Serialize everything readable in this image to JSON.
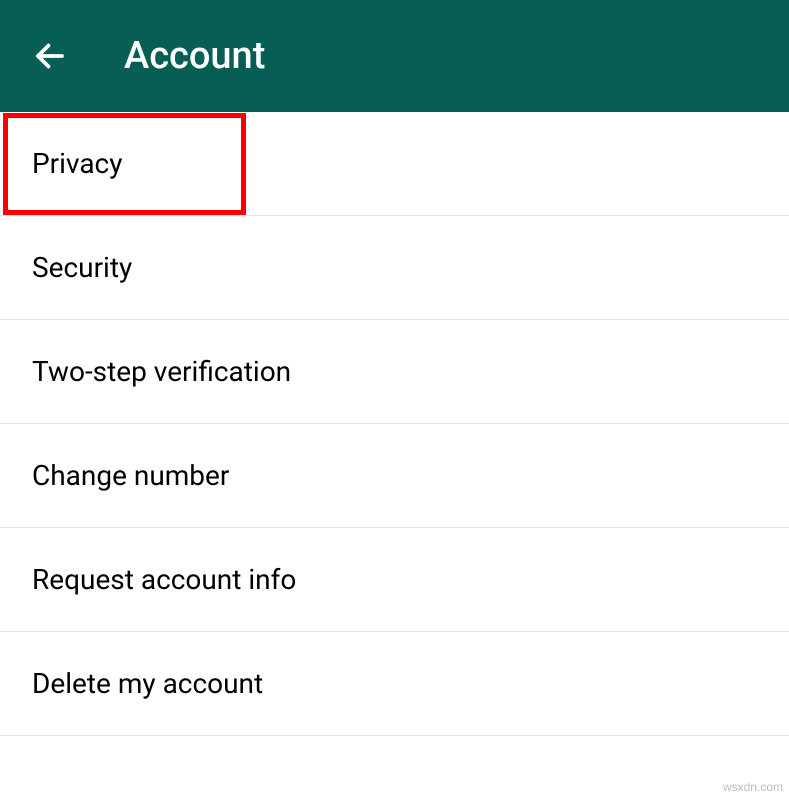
{
  "header": {
    "title": "Account"
  },
  "items": [
    {
      "label": "Privacy"
    },
    {
      "label": "Security"
    },
    {
      "label": "Two-step verification"
    },
    {
      "label": "Change number"
    },
    {
      "label": "Request account info"
    },
    {
      "label": "Delete my account"
    }
  ],
  "watermark": "wsxdn.com"
}
